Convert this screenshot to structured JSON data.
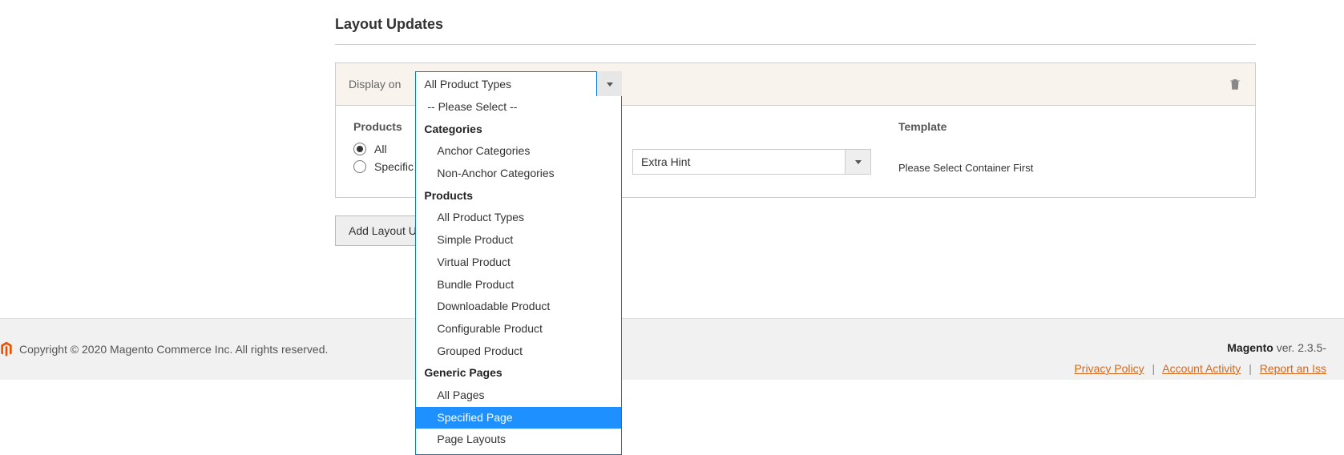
{
  "section": {
    "title": "Layout Updates"
  },
  "block": {
    "display_on_label": "Display on",
    "display_on_value": "All Product Types",
    "dropdown": {
      "please_select": "-- Please Select --",
      "groups": {
        "categories": {
          "label": "Categories",
          "items": [
            "Anchor Categories",
            "Non-Anchor Categories"
          ]
        },
        "products": {
          "label": "Products",
          "items": [
            "All Product Types",
            "Simple Product",
            "Virtual Product",
            "Bundle Product",
            "Downloadable Product",
            "Configurable Product",
            "Grouped Product"
          ]
        },
        "generic": {
          "label": "Generic Pages",
          "items": [
            "All Pages",
            "Specified Page",
            "Page Layouts"
          ]
        }
      },
      "highlighted": "Specified Page"
    }
  },
  "body": {
    "products_label": "Products",
    "radio_all": "All",
    "radio_specific": "Specific",
    "hint_value": "Extra Hint",
    "template_label": "Template",
    "template_msg": "Please Select Container First"
  },
  "add_button": "Add Layout U",
  "footer": {
    "copyright": "Copyright © 2020 Magento Commerce Inc. All rights reserved.",
    "brand": "Magento",
    "ver_prefix": " ver. ",
    "version": "2.3.5-",
    "links": {
      "privacy": "Privacy Policy",
      "activity": "Account Activity",
      "report": "Report an Iss"
    }
  }
}
